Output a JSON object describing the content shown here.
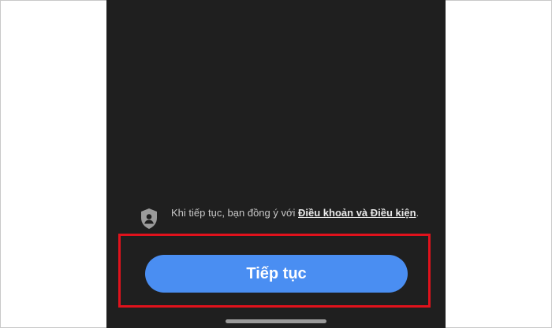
{
  "consent": {
    "prefix": "Khi tiếp tục, bạn đồng ý với ",
    "link_text": "Điều khoản và Điều kiện",
    "suffix": ".",
    "icon": "shield-user-icon"
  },
  "primary_action": {
    "label": "Tiếp tục",
    "color": "#4a8ef2"
  },
  "colors": {
    "screen_background": "#1f1f1f",
    "highlight": "#e0121c"
  }
}
